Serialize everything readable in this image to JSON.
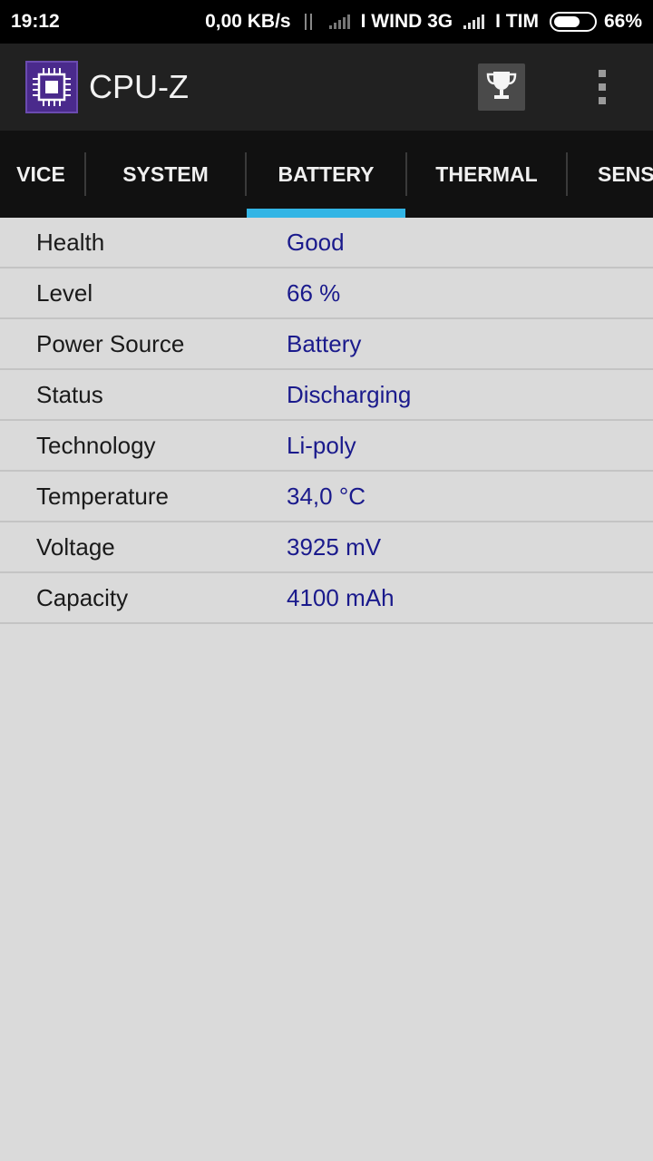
{
  "status_bar": {
    "time": "19:12",
    "net_speed": "0,00 KB/s",
    "carrier1": "I WIND 3G",
    "carrier2": "I TIM",
    "battery_percent": "66%",
    "battery_level": 0.66
  },
  "app_bar": {
    "title": "CPU-Z",
    "logo_icon": "cpu-chip-icon",
    "trophy_icon": "trophy-icon",
    "menu_icon": "more-vert-icon"
  },
  "tabs": [
    {
      "label": "VICE"
    },
    {
      "label": "SYSTEM"
    },
    {
      "label": "BATTERY",
      "active": true
    },
    {
      "label": "THERMAL"
    },
    {
      "label": "SENS"
    }
  ],
  "accent_color": "#33b5e5",
  "battery_info": {
    "rows": [
      {
        "label": "Health",
        "value": "Good"
      },
      {
        "label": "Level",
        "value": "66 %"
      },
      {
        "label": "Power Source",
        "value": "Battery"
      },
      {
        "label": "Status",
        "value": "Discharging"
      },
      {
        "label": "Technology",
        "value": "Li-poly"
      },
      {
        "label": "Temperature",
        "value": "34,0 °C"
      },
      {
        "label": "Voltage",
        "value": "3925 mV"
      },
      {
        "label": "Capacity",
        "value": "4100 mAh"
      }
    ]
  }
}
